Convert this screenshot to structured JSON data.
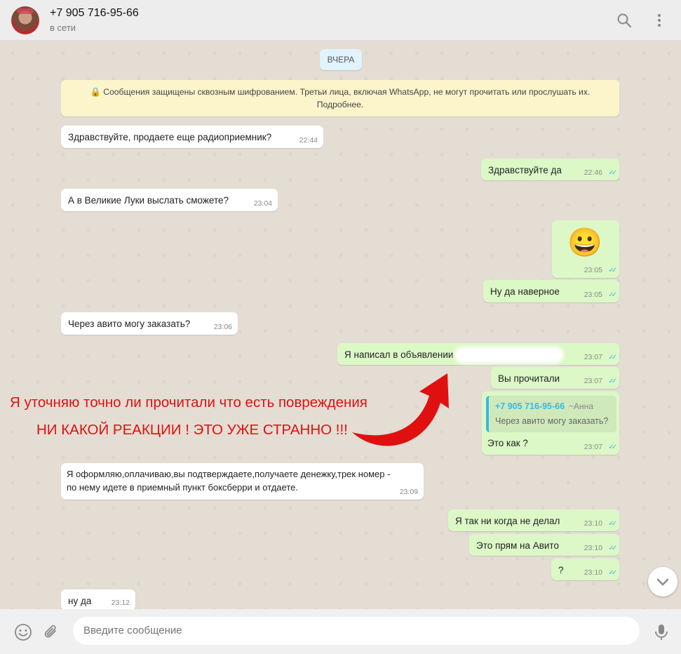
{
  "header": {
    "contact_name": "+7 905 716-95-66",
    "status": "в сети",
    "icons": [
      "search-icon",
      "menu-icon"
    ]
  },
  "chat": {
    "date_label": "ВЧЕРА",
    "encryption_notice": "🔒 Сообщения защищены сквозным шифрованием. Третьи лица, включая WhatsApp, не могут прочитать или прослушать их. Подробнее.",
    "messages": [
      {
        "dir": "in",
        "text": "Здравствуйте, продаете еще радиоприемник?",
        "time": "22:44"
      },
      {
        "dir": "out",
        "text": "Здравствуйте да",
        "time": "22:46"
      },
      {
        "dir": "in",
        "text": "А в Великие Луки выслать сможете?",
        "time": "23:04"
      },
      {
        "dir": "out",
        "text": "😀",
        "time": "23:05"
      },
      {
        "dir": "out",
        "text": "Ну да наверное",
        "time": "23:05"
      },
      {
        "dir": "in",
        "text": "Через авито могу заказать?",
        "time": "23:06"
      },
      {
        "dir": "out",
        "text": "Я написал в объявлении",
        "time": "23:07"
      },
      {
        "dir": "out",
        "text": "Вы прочитали",
        "time": "23:07"
      },
      {
        "dir": "out",
        "text": "Это как ?",
        "time": "23:07",
        "quote": {
          "author": "+7 905 716-95-66",
          "author_name": "~Анна",
          "text": "Через авито могу заказать?"
        }
      },
      {
        "dir": "in",
        "text_line1": "Я оформляю,оплачиваю,вы подтверждаете,получаете денежку,трек номер -",
        "text_line2": "по нему идете в приемный пункт боксберри и отдаете.",
        "time": "23:09"
      },
      {
        "dir": "out",
        "text": "Я так ни когда не делал",
        "time": "23:10"
      },
      {
        "dir": "out",
        "text": "Это прям на Авито",
        "time": "23:10"
      },
      {
        "dir": "out",
        "text": "?",
        "time": "23:10"
      },
      {
        "dir": "in",
        "text": "ну да",
        "time": "23:12"
      }
    ],
    "tick_glyph": "✓✓"
  },
  "annotations": {
    "line1": "Я уточняю точно ли прочитали что есть повреждения",
    "line2": "НИ КАКОЙ РЕАКЦИИ ! ЭТО УЖЕ СТРАННО !!!",
    "color": "#e01010"
  },
  "footer": {
    "placeholder": "Введите сообщение",
    "icons": [
      "emoji-icon",
      "attach-icon",
      "mic-icon"
    ]
  }
}
